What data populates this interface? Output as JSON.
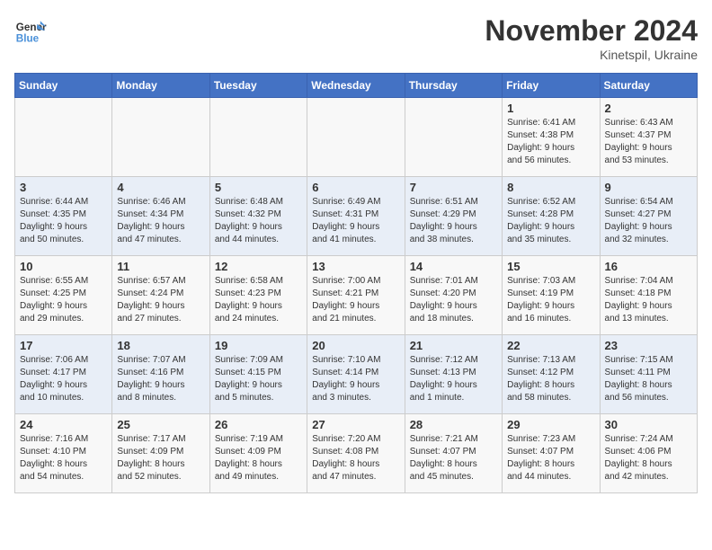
{
  "logo": {
    "general": "General",
    "blue": "Blue"
  },
  "title": {
    "month_year": "November 2024",
    "location": "Kinetspil, Ukraine"
  },
  "headers": [
    "Sunday",
    "Monday",
    "Tuesday",
    "Wednesday",
    "Thursday",
    "Friday",
    "Saturday"
  ],
  "weeks": [
    [
      {
        "day": "",
        "info": ""
      },
      {
        "day": "",
        "info": ""
      },
      {
        "day": "",
        "info": ""
      },
      {
        "day": "",
        "info": ""
      },
      {
        "day": "",
        "info": ""
      },
      {
        "day": "1",
        "info": "Sunrise: 6:41 AM\nSunset: 4:38 PM\nDaylight: 9 hours\nand 56 minutes."
      },
      {
        "day": "2",
        "info": "Sunrise: 6:43 AM\nSunset: 4:37 PM\nDaylight: 9 hours\nand 53 minutes."
      }
    ],
    [
      {
        "day": "3",
        "info": "Sunrise: 6:44 AM\nSunset: 4:35 PM\nDaylight: 9 hours\nand 50 minutes."
      },
      {
        "day": "4",
        "info": "Sunrise: 6:46 AM\nSunset: 4:34 PM\nDaylight: 9 hours\nand 47 minutes."
      },
      {
        "day": "5",
        "info": "Sunrise: 6:48 AM\nSunset: 4:32 PM\nDaylight: 9 hours\nand 44 minutes."
      },
      {
        "day": "6",
        "info": "Sunrise: 6:49 AM\nSunset: 4:31 PM\nDaylight: 9 hours\nand 41 minutes."
      },
      {
        "day": "7",
        "info": "Sunrise: 6:51 AM\nSunset: 4:29 PM\nDaylight: 9 hours\nand 38 minutes."
      },
      {
        "day": "8",
        "info": "Sunrise: 6:52 AM\nSunset: 4:28 PM\nDaylight: 9 hours\nand 35 minutes."
      },
      {
        "day": "9",
        "info": "Sunrise: 6:54 AM\nSunset: 4:27 PM\nDaylight: 9 hours\nand 32 minutes."
      }
    ],
    [
      {
        "day": "10",
        "info": "Sunrise: 6:55 AM\nSunset: 4:25 PM\nDaylight: 9 hours\nand 29 minutes."
      },
      {
        "day": "11",
        "info": "Sunrise: 6:57 AM\nSunset: 4:24 PM\nDaylight: 9 hours\nand 27 minutes."
      },
      {
        "day": "12",
        "info": "Sunrise: 6:58 AM\nSunset: 4:23 PM\nDaylight: 9 hours\nand 24 minutes."
      },
      {
        "day": "13",
        "info": "Sunrise: 7:00 AM\nSunset: 4:21 PM\nDaylight: 9 hours\nand 21 minutes."
      },
      {
        "day": "14",
        "info": "Sunrise: 7:01 AM\nSunset: 4:20 PM\nDaylight: 9 hours\nand 18 minutes."
      },
      {
        "day": "15",
        "info": "Sunrise: 7:03 AM\nSunset: 4:19 PM\nDaylight: 9 hours\nand 16 minutes."
      },
      {
        "day": "16",
        "info": "Sunrise: 7:04 AM\nSunset: 4:18 PM\nDaylight: 9 hours\nand 13 minutes."
      }
    ],
    [
      {
        "day": "17",
        "info": "Sunrise: 7:06 AM\nSunset: 4:17 PM\nDaylight: 9 hours\nand 10 minutes."
      },
      {
        "day": "18",
        "info": "Sunrise: 7:07 AM\nSunset: 4:16 PM\nDaylight: 9 hours\nand 8 minutes."
      },
      {
        "day": "19",
        "info": "Sunrise: 7:09 AM\nSunset: 4:15 PM\nDaylight: 9 hours\nand 5 minutes."
      },
      {
        "day": "20",
        "info": "Sunrise: 7:10 AM\nSunset: 4:14 PM\nDaylight: 9 hours\nand 3 minutes."
      },
      {
        "day": "21",
        "info": "Sunrise: 7:12 AM\nSunset: 4:13 PM\nDaylight: 9 hours\nand 1 minute."
      },
      {
        "day": "22",
        "info": "Sunrise: 7:13 AM\nSunset: 4:12 PM\nDaylight: 8 hours\nand 58 minutes."
      },
      {
        "day": "23",
        "info": "Sunrise: 7:15 AM\nSunset: 4:11 PM\nDaylight: 8 hours\nand 56 minutes."
      }
    ],
    [
      {
        "day": "24",
        "info": "Sunrise: 7:16 AM\nSunset: 4:10 PM\nDaylight: 8 hours\nand 54 minutes."
      },
      {
        "day": "25",
        "info": "Sunrise: 7:17 AM\nSunset: 4:09 PM\nDaylight: 8 hours\nand 52 minutes."
      },
      {
        "day": "26",
        "info": "Sunrise: 7:19 AM\nSunset: 4:09 PM\nDaylight: 8 hours\nand 49 minutes."
      },
      {
        "day": "27",
        "info": "Sunrise: 7:20 AM\nSunset: 4:08 PM\nDaylight: 8 hours\nand 47 minutes."
      },
      {
        "day": "28",
        "info": "Sunrise: 7:21 AM\nSunset: 4:07 PM\nDaylight: 8 hours\nand 45 minutes."
      },
      {
        "day": "29",
        "info": "Sunrise: 7:23 AM\nSunset: 4:07 PM\nDaylight: 8 hours\nand 44 minutes."
      },
      {
        "day": "30",
        "info": "Sunrise: 7:24 AM\nSunset: 4:06 PM\nDaylight: 8 hours\nand 42 minutes."
      }
    ]
  ]
}
